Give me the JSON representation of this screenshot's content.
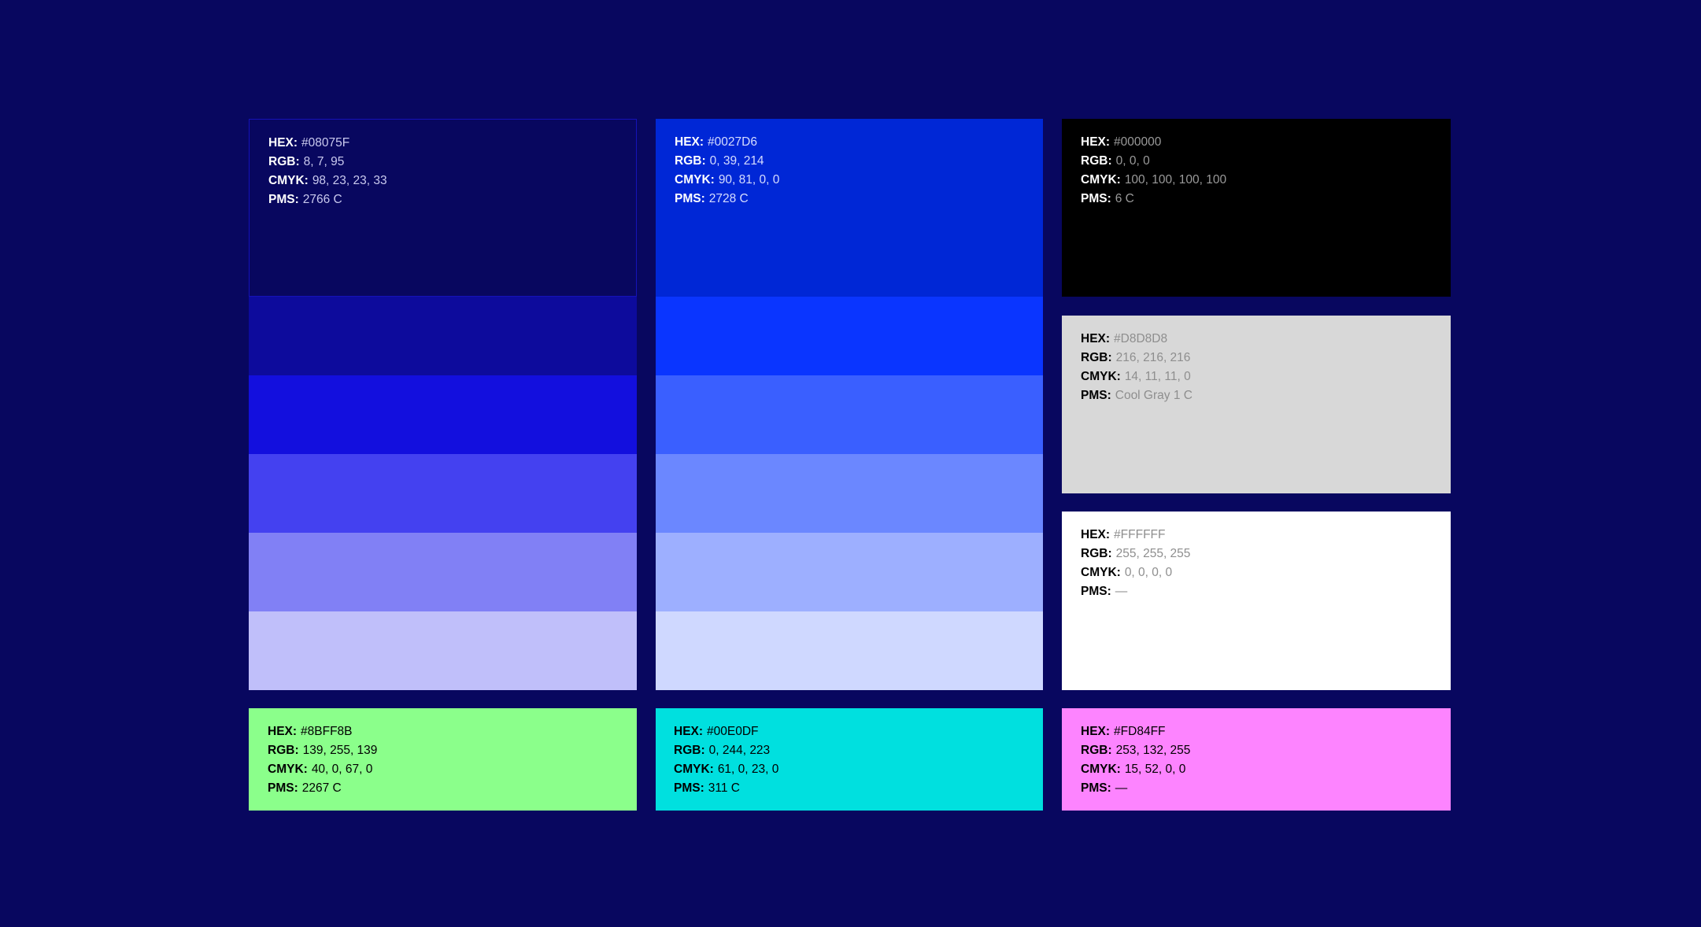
{
  "labels": {
    "hex": "HEX:",
    "rgb": "RGB:",
    "cmyk": "CMYK:",
    "pms": "PMS:"
  },
  "swatches": {
    "navy": {
      "hex": "#08075F",
      "rgb": "8, 7, 95",
      "cmyk": "98, 23, 23, 33",
      "pms": "2766 C"
    },
    "blue": {
      "hex": "#0027D6",
      "rgb": "0, 39, 214",
      "cmyk": "90, 81, 0, 0",
      "pms": "2728 C"
    },
    "black": {
      "hex": "#000000",
      "rgb": "0, 0, 0",
      "cmyk": "100, 100, 100, 100",
      "pms": "6 C"
    },
    "gray": {
      "hex": "#D8D8D8",
      "rgb": "216, 216, 216",
      "cmyk": "14, 11, 11, 0",
      "pms": "Cool Gray 1 C"
    },
    "white": {
      "hex": "#FFFFFF",
      "rgb": "255, 255, 255",
      "cmyk": "0, 0, 0, 0",
      "pms": "—"
    },
    "green": {
      "hex": "#8BFF8B",
      "rgb": "139, 255, 139",
      "cmyk": "40, 0, 67, 0",
      "pms": "2267 C"
    },
    "cyan": {
      "hex": "#00E0DF",
      "rgb": "0, 244, 223",
      "cmyk": "61, 0, 23, 0",
      "pms": "311 C"
    },
    "pink": {
      "hex": "#FD84FF",
      "rgb": "253, 132, 255",
      "cmyk": "15, 52, 0, 0",
      "pms": "—"
    }
  },
  "tint_colors": {
    "navy": [
      "#0D0B9C",
      "#130FDE",
      "#4441F0",
      "#8180F5",
      "#C0BFFA"
    ],
    "blue": [
      "#0A35FF",
      "#3A5FFF",
      "#6B87FF",
      "#9DAFFF",
      "#CFD8FF"
    ]
  },
  "text_colors": {
    "light_label": "#FFFFFF",
    "light_value": "#C9C9EE",
    "dark_label": "#000000",
    "dark_value": "#000000",
    "muted_value": "#8E8E8E"
  }
}
